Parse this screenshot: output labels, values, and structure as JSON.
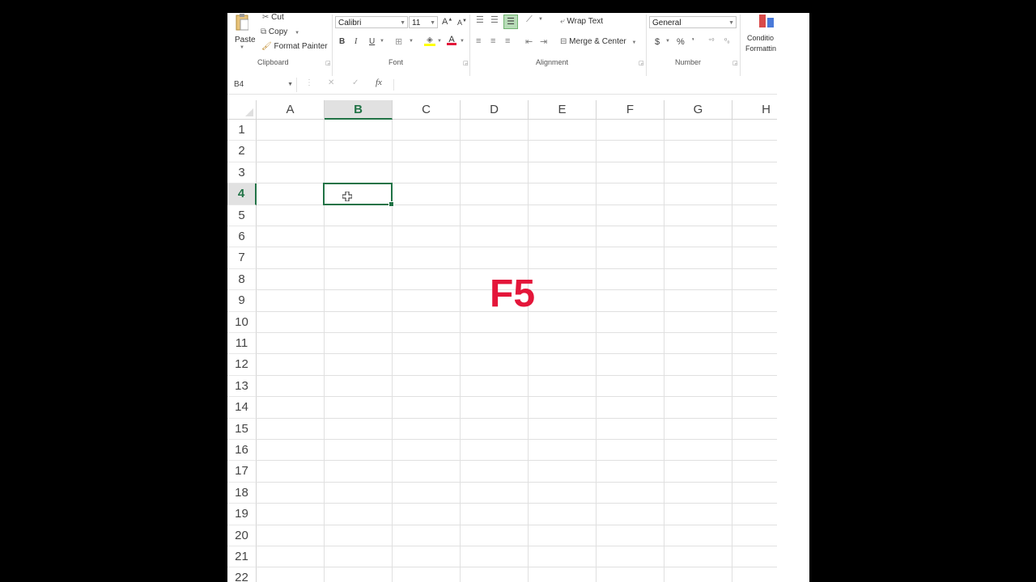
{
  "ribbon": {
    "clipboard": {
      "group_label": "Clipboard",
      "paste_label": "Paste",
      "cut_label": "Cut",
      "copy_label": "Copy",
      "format_painter_label": "Format Painter"
    },
    "font": {
      "group_label": "Font",
      "font_name": "Calibri",
      "font_size": "11",
      "grow_label": "A",
      "shrink_label": "A",
      "bold_label": "B",
      "italic_label": "I",
      "underline_label": "U",
      "font_color_label": "A"
    },
    "alignment": {
      "group_label": "Alignment",
      "wrap_text_label": "Wrap Text",
      "merge_center_label": "Merge & Center"
    },
    "number": {
      "group_label": "Number",
      "format_value": "General",
      "currency_label": "$",
      "percent_label": "%"
    },
    "styles": {
      "conditional_formatting_line1": "Conditio",
      "conditional_formatting_line2": "Formattin"
    }
  },
  "formula_bar": {
    "name_box": "B4",
    "fx_label": "fx",
    "cancel_label": "✕",
    "enter_label": "✓",
    "content": ""
  },
  "grid": {
    "columns": [
      "A",
      "B",
      "C",
      "D",
      "E",
      "F",
      "G",
      "H"
    ],
    "rows": [
      "1",
      "2",
      "3",
      "4",
      "5",
      "6",
      "7",
      "8",
      "9",
      "10",
      "11",
      "12",
      "13",
      "14",
      "15",
      "16",
      "17",
      "18",
      "19",
      "20",
      "21",
      "22"
    ],
    "selected_column": "B",
    "selected_row": "4"
  },
  "overlay": {
    "key_label": "F5"
  },
  "colors": {
    "accent_green": "#217346",
    "overlay_red": "#e4163a",
    "header_bg": "#e1e1e1"
  }
}
